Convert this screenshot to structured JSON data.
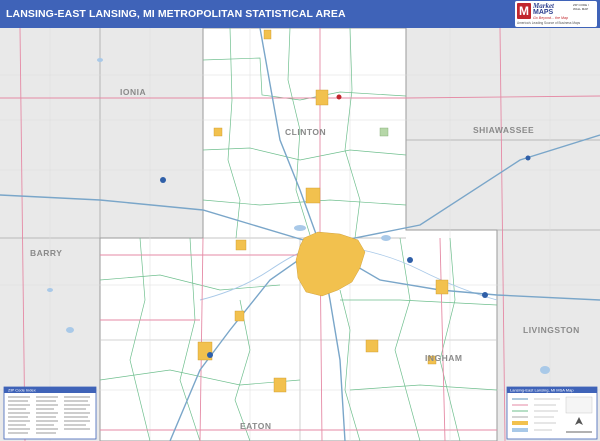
{
  "header": {
    "title": "LANSING-EAST LANSING, MI METROPOLITAN STATISTICAL AREA"
  },
  "logo": {
    "letter": "M",
    "brand_top": "Market",
    "brand_bottom": "MAPS",
    "tagline": "Go Beyond... the Map",
    "subtitle": "America's Leading Source of Business Maps",
    "info": "ZIP CODE / WALL MAP"
  },
  "map": {
    "counties": [
      "IONIA",
      "CLINTON",
      "SHIAWASSEE",
      "BARRY",
      "LIVINGSTON",
      "INGHAM",
      "EATON"
    ],
    "zip_index_title": "ZIP Code Index",
    "legend_title": "Lansing-East Lansing, MI MSA Map",
    "colors": {
      "urban": "#f2c14e",
      "urban_edge": "#c8952a",
      "msa_fill": "#ffffff",
      "outside_fill": "#e9e9e9",
      "county_line": "#a8a8a8",
      "zip_line": "#6fbf8e",
      "highway": "#7aa6c9",
      "road": "#e58aa5",
      "water": "#a9c9e8",
      "header": "#3f63b8"
    }
  }
}
